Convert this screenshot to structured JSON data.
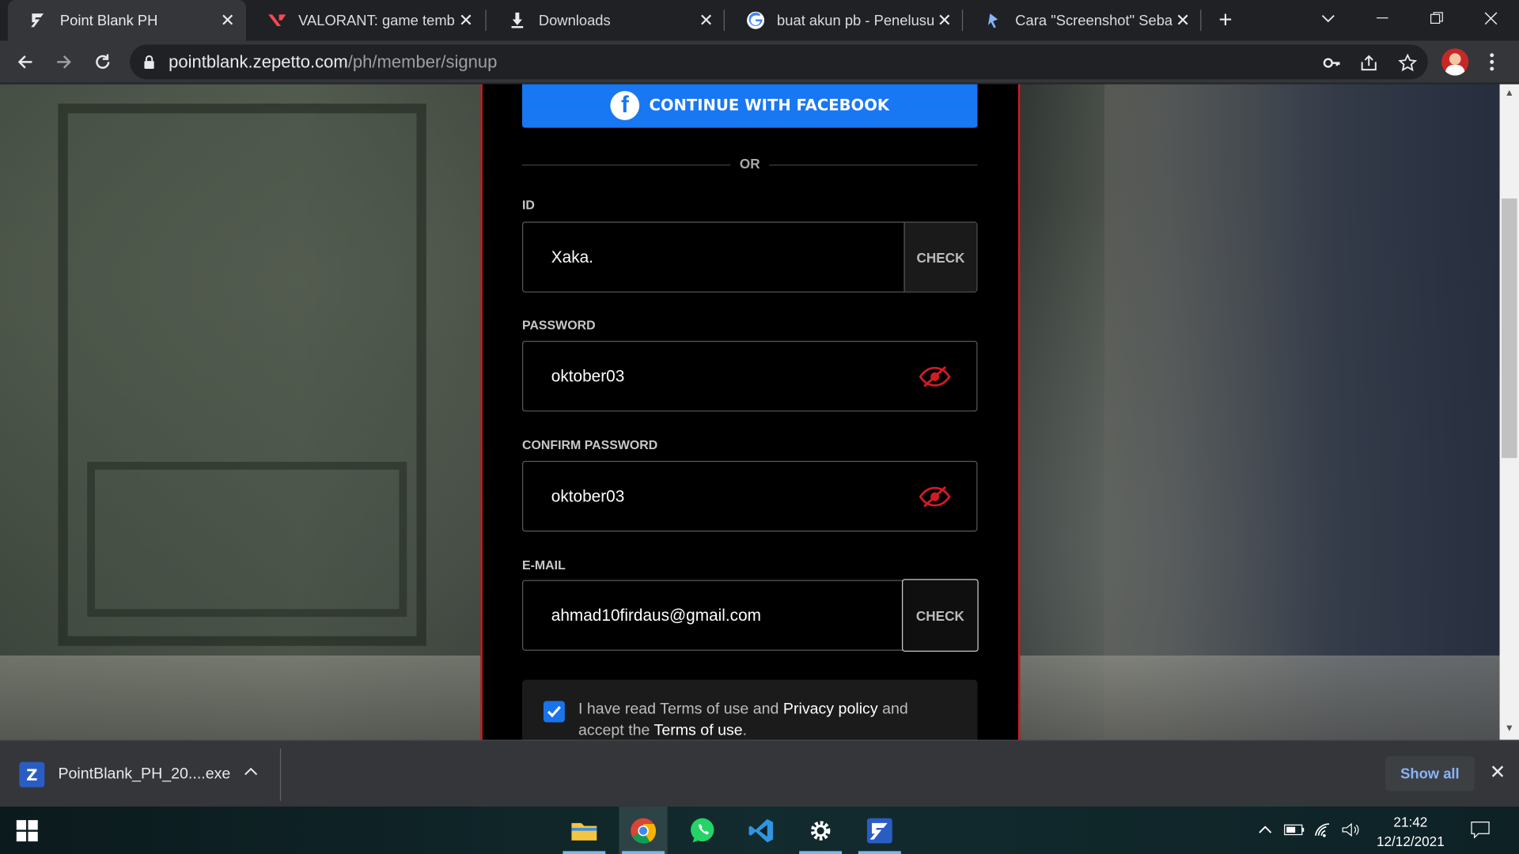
{
  "browser": {
    "tabs": [
      {
        "title": "Point Blank PH",
        "icon": "point-blank-logo-icon",
        "active": true
      },
      {
        "title": "VALORANT: game tembak",
        "icon": "valorant-logo-icon",
        "active": false
      },
      {
        "title": "Downloads",
        "icon": "download-icon",
        "active": false
      },
      {
        "title": "buat akun pb - Penelusur",
        "icon": "google-logo-icon",
        "active": false
      },
      {
        "title": "Cara \"Screenshot\" Sebagi",
        "icon": "page-icon",
        "active": false
      }
    ],
    "url": {
      "host": "pointblank.zepetto.com",
      "path": "/ph/member/signup"
    }
  },
  "page": {
    "facebook_button": "CONTINUE WITH FACEBOOK",
    "or_text": "OR",
    "id_label": "ID",
    "id_value": "Xaka.",
    "check_label": "CHECK",
    "password_label": "PASSWORD",
    "password_value": "oktober03",
    "confirm_label": "CONFIRM PASSWORD",
    "confirm_value": "oktober03",
    "email_label": "E-MAIL",
    "email_value": "ahmad10firdaus@gmail.com",
    "email_check_label": "CHECK",
    "terms": {
      "part1": "I have read Terms of use and ",
      "link1": "Privacy policy",
      "part2": " and accept the ",
      "link2": "Terms of use",
      "part3": "."
    }
  },
  "download_bar": {
    "file_name": "PointBlank_PH_20....exe",
    "show_all": "Show all"
  },
  "taskbar": {
    "time": "21:42",
    "date": "12/12/2021"
  },
  "colors": {
    "facebook_blue": "#1877f2",
    "panel_border_red": "#d21c24",
    "eye_icon_red": "#d21c24",
    "checkbox_blue": "#1a73e8"
  }
}
